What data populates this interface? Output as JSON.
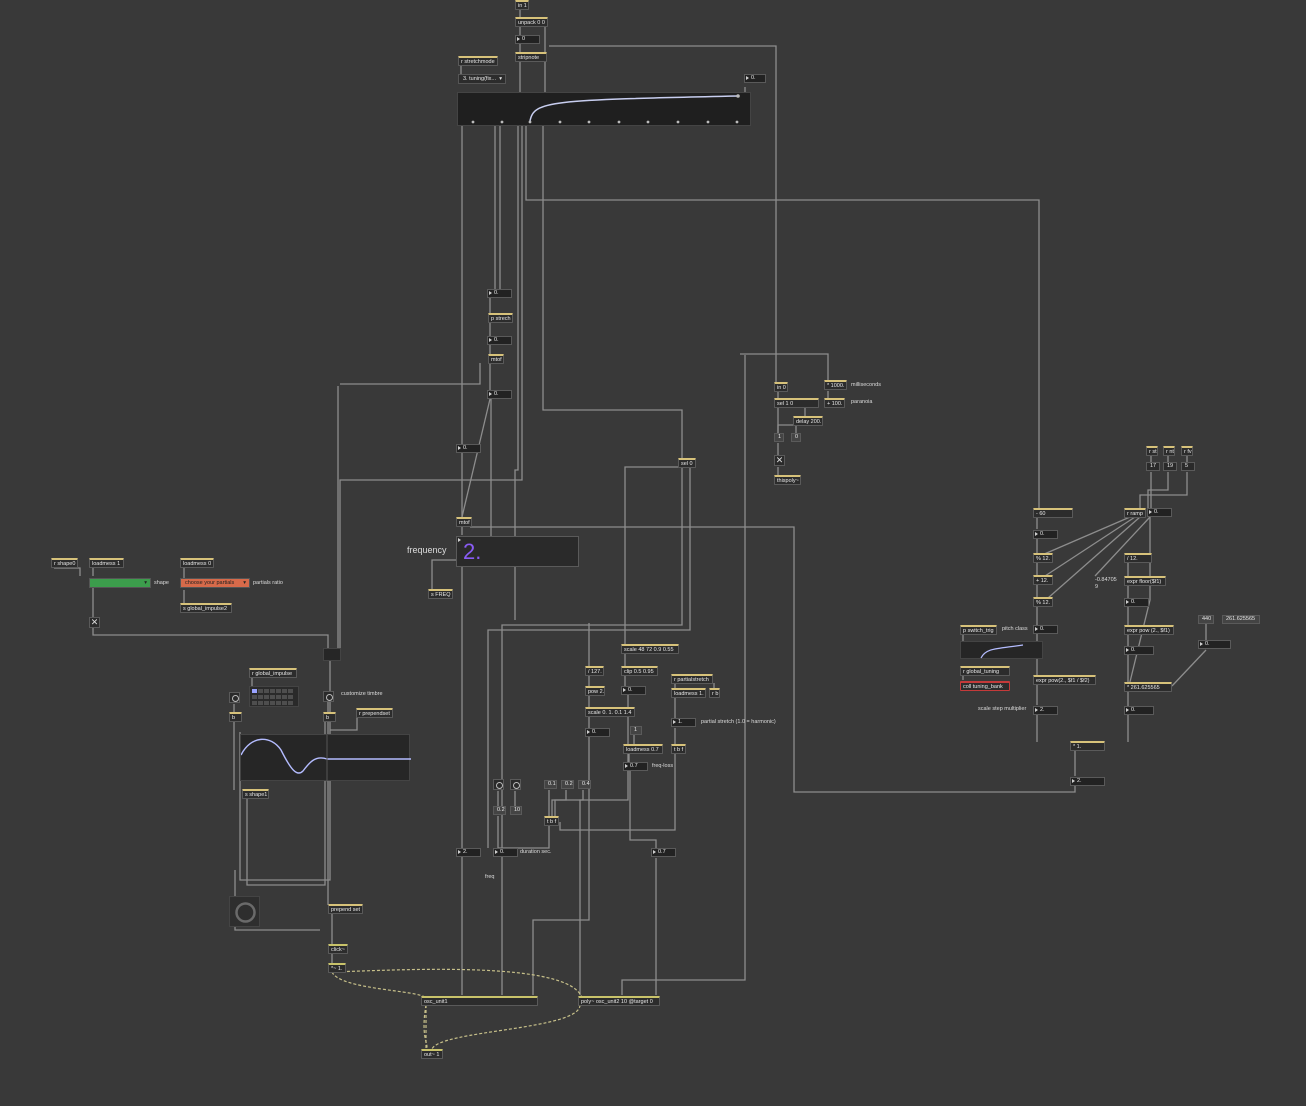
{
  "objects": {
    "in1": "in 1",
    "unpack": "unpack 0 0",
    "num_unpack": "0",
    "stripnote": "stripnote",
    "r_stretchmode": "r stretchmode",
    "tuning_menu": "3. tuning(fix...",
    "num_top_right": "0.",
    "num_a1": "0.",
    "p_strech": "p strech",
    "num_a2": "0.",
    "mtof_1": "mtof",
    "num_a3": "0.",
    "num_a4": "0.",
    "mtof_2": "mtof",
    "frequency_label": "frequency",
    "frequency_value": "2.",
    "s_freq": "s FREQ",
    "sel_0": "sel 0",
    "scale_48": "scale 48 72 0.9 0.55",
    "div_127": "/ 127.",
    "clip": "clip 0.5 0.95",
    "num_clip": "0.",
    "pow2": "pow 2.",
    "scale_01": "scale 0. 1. 0.1 1.4",
    "num_scale": "0.",
    "msg_1": "1",
    "loadmess_07": "loadmess 0.7",
    "num_07a": "0.7",
    "freq_loss": "freq-loss",
    "r_partialstretch": "r partialstretch",
    "loadmess_1b": "loadmess 1.",
    "r_b": "r b",
    "num_partial": "1.",
    "partial_stretch_label": "partial stretch (1.0 = harmonic)",
    "tbf_1": "t b f",
    "msg_01": "0.1",
    "msg_02a": "0.2",
    "msg_04": "0.4",
    "msg_02b": "0.2",
    "msg_10": "10",
    "tbf_2": "t b f",
    "num_2": "2.",
    "num_dur": "0.",
    "duration_label": "duration sec.",
    "num_07b": "0.7",
    "freq_label": "freq",
    "osc_unit1": "osc_unit1",
    "poly": "poly~ osc_unit2 10 @target 0",
    "out": "out~ 1",
    "click": "click~",
    "times1": "*~ 1.",
    "prepend_set": "prepend set",
    "r_shape0": "r shape0",
    "loadmess_1": "loadmess 1",
    "shape_label": "shape",
    "loadmess_0": "loadmess 0",
    "partials_menu": "choose your partials",
    "partials_ratio_label": "partials ratio",
    "s_global_impulse2": "s global_impulse2",
    "r_global_impulse": "r global_impulse",
    "customize_label": "customize timbre",
    "r_prependset": "r prependset",
    "b_1": "b",
    "b_2": "b",
    "s_shape1": "s shape1",
    "in_0": "in 0",
    "times_1000": "* 1000.",
    "milliseconds_label": "milliseconds",
    "sel_10": "sel 1 0",
    "plus_100": "+ 100.",
    "paranoia_label": "paranoia",
    "delay": "delay 200.",
    "msg_1b": "1",
    "msg_0": "0",
    "thispoly": "thispoly~",
    "r_st": "r st",
    "r_nt": "r nt",
    "r_fv": "r fv",
    "num_17": "17",
    "num_19": "19",
    "num_5": "5",
    "r_ramp": "r ramp",
    "num_ramp": "0.",
    "minus_60": "- 60",
    "num_b1": "0.",
    "mod_12a": "% 12.",
    "plus_12": "+ 12.",
    "mod_12b": "% 12.",
    "div_12": "/ 12.",
    "neg_val": "-0.84705",
    "neg_val2": "9",
    "expr_floor": "expr floor($f1)",
    "num_floor": "0.",
    "expr_pow": "expr pow (2., $f1)",
    "num_pow": "0.",
    "times_261": "* 261.625565",
    "num_261": "0.",
    "msg_440": "440",
    "msg_261": "261.625565",
    "num_440": "0.",
    "p_switch": "p switch_trig",
    "pitch_class_label": "pitch class",
    "num_pitch": "0.",
    "r_global_tuning": "r global_tuning",
    "coll": "coll tuning_bank",
    "expr_pow2": "expr pow(2., $f1 / $f2)",
    "scale_step_label": "scale step multiplier",
    "num_step": "2.",
    "times_1": "* 1.",
    "num_final": "2."
  }
}
